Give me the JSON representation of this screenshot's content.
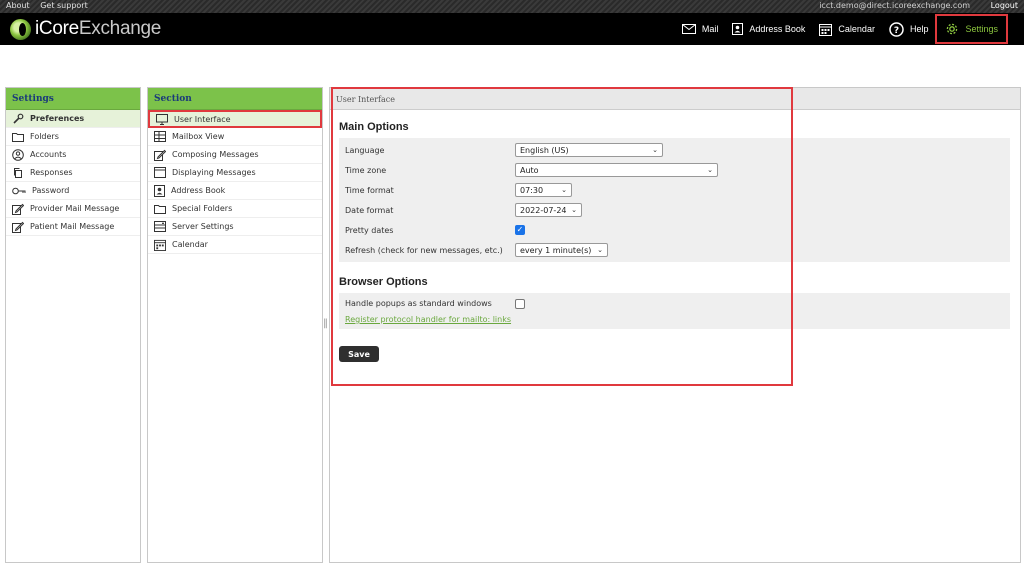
{
  "topbar": {
    "about": "About",
    "support": "Get support",
    "email": "icct.demo@direct.icoreexchange.com",
    "logout": "Logout"
  },
  "brand": {
    "name_a": "iCore",
    "name_b": "Exchange"
  },
  "nav": [
    {
      "label": "Mail",
      "icon": "mail-icon"
    },
    {
      "label": "Address Book",
      "icon": "address-book-icon"
    },
    {
      "label": "Calendar",
      "icon": "calendar-icon"
    },
    {
      "label": "Help",
      "icon": "help-icon"
    },
    {
      "label": "Settings",
      "icon": "gear-icon",
      "active": true
    }
  ],
  "settings_panel": {
    "title": "Settings",
    "items": [
      {
        "label": "Preferences",
        "icon": "wrench-icon"
      },
      {
        "label": "Folders",
        "icon": "folder-icon"
      },
      {
        "label": "Accounts",
        "icon": "user-circle-icon"
      },
      {
        "label": "Responses",
        "icon": "copy-icon"
      },
      {
        "label": "Password",
        "icon": "key-icon"
      },
      {
        "label": "Provider Mail Message",
        "icon": "edit-icon"
      },
      {
        "label": "Patient Mail Message",
        "icon": "edit-icon"
      }
    ]
  },
  "section_panel": {
    "title": "Section",
    "items": [
      {
        "label": "User Interface",
        "icon": "monitor-icon"
      },
      {
        "label": "Mailbox View",
        "icon": "grid-icon"
      },
      {
        "label": "Composing Messages",
        "icon": "edit-icon"
      },
      {
        "label": "Displaying Messages",
        "icon": "window-icon"
      },
      {
        "label": "Address Book",
        "icon": "address-book-icon"
      },
      {
        "label": "Special Folders",
        "icon": "folder-icon"
      },
      {
        "label": "Server Settings",
        "icon": "server-icon"
      },
      {
        "label": "Calendar",
        "icon": "calendar-icon"
      }
    ]
  },
  "main": {
    "title": "User Interface",
    "main_options": {
      "title": "Main Options",
      "language": {
        "label": "Language",
        "value": "English (US)"
      },
      "timezone": {
        "label": "Time zone",
        "value": "Auto"
      },
      "time_format": {
        "label": "Time format",
        "value": "07:30"
      },
      "date_format": {
        "label": "Date format",
        "value": "2022-07-24"
      },
      "pretty_dates": {
        "label": "Pretty dates",
        "checked": true
      },
      "refresh": {
        "label": "Refresh (check for new messages, etc.)",
        "value": "every 1 minute(s)"
      }
    },
    "browser_options": {
      "title": "Browser Options",
      "popups": {
        "label": "Handle popups as standard windows",
        "checked": false
      },
      "protocol_link": "Register protocol handler for mailto: links"
    },
    "save_label": "Save"
  },
  "colors": {
    "accent_green": "#7cc24a",
    "highlight_red": "#e0393e",
    "header_black": "#000000"
  }
}
